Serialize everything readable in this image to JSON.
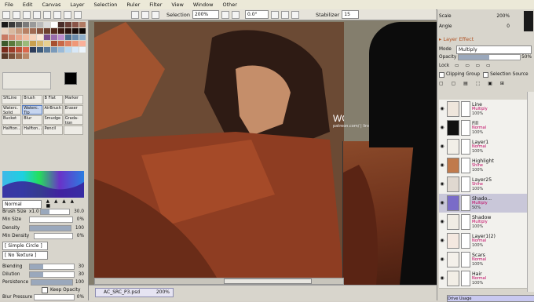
{
  "menu": [
    "File",
    "Edit",
    "Canvas",
    "Layer",
    "Selection",
    "Ruler",
    "Filter",
    "View",
    "Window",
    "Other"
  ],
  "toolbar": {
    "selection_label": "Selection",
    "zoom": "200%",
    "angle": "0.0°",
    "stabilizer_label": "Stabilizer",
    "stabilizer_value": "15"
  },
  "navigator": {
    "scale_label": "Scale",
    "scale_value": "200%",
    "angle_label": "Angle",
    "angle_value": "0"
  },
  "tools": [
    {
      "label": "SftLine"
    },
    {
      "label": "Brush"
    },
    {
      "label": "B Flat"
    },
    {
      "label": "Marker"
    },
    {
      "label": "Waterc. Solid"
    },
    {
      "label": "Waterc. Tip"
    },
    {
      "label": "AirBrush"
    },
    {
      "label": "Eraser"
    },
    {
      "label": "Bucket"
    },
    {
      "label": "Blur"
    },
    {
      "label": "Smudge"
    },
    {
      "label": "Grada-tion"
    },
    {
      "label": "Halfton..."
    },
    {
      "label": "Halfton..."
    },
    {
      "label": "Pencil"
    },
    {
      "label": ""
    }
  ],
  "brush": {
    "blend_mode": "Normal",
    "brush_size_label": "Brush Size",
    "brush_size_mult": "x1.0",
    "brush_size_value": "30.0",
    "min_size_label": "Min Size",
    "min_size_value": "0%",
    "density_label": "Density",
    "density_value": "100",
    "min_density_label": "Min Density",
    "min_density_value": "0%",
    "shape": "[ Simple Circle ]",
    "texture": "[ No Texture ]",
    "blending_label": "Blending",
    "blending_value": "30",
    "dilution_label": "Dilution",
    "dilution_value": "30",
    "persistence_label": "Persistence",
    "persistence_value": "100",
    "keep_opacity_label": "Keep Opacity",
    "blur_pressure_label": "Blur Pressure",
    "blur_pressure_value": "0%"
  },
  "layer_panel": {
    "effect_label": "Layer Effect",
    "mode_label": "Mode",
    "mode_value": "Multiply",
    "opacity_label": "Opacity",
    "opacity_value": "50%",
    "lock_label": "Lock",
    "clipping_label": "Clipping Group",
    "selection_source_label": "Selection Source",
    "layers": [
      {
        "name": "Line",
        "mode": "Multiply",
        "opacity": "100%"
      },
      {
        "name": "Fill",
        "mode": "Normal",
        "opacity": "100%"
      },
      {
        "name": "Layer1",
        "mode": "Normal",
        "opacity": "100%"
      },
      {
        "name": "Highlight",
        "mode": "Shine",
        "opacity": "100%"
      },
      {
        "name": "Layer25",
        "mode": "Shine",
        "opacity": "100%"
      },
      {
        "name": "Shado...",
        "mode": "Multiply",
        "opacity": "50%"
      },
      {
        "name": "Shadow",
        "mode": "Multiply",
        "opacity": "100%"
      },
      {
        "name": "Layer1(2)",
        "mode": "Normal",
        "opacity": "100%"
      },
      {
        "name": "Scars",
        "mode": "Normal",
        "opacity": "100%"
      },
      {
        "name": "Hair",
        "mode": "Normal",
        "opacity": "100%"
      }
    ],
    "drive_usage_label": "Drive Usage"
  },
  "canvas": {
    "watermark": "WORK IN PROGRESS",
    "watermark_sub": "patreon.com/ | linsloverfable"
  },
  "status": {
    "filename": "AC_SRC_P3.psd",
    "zoom": "200%"
  },
  "colors": {
    "primary": "#000000",
    "secondary": "#ffffff",
    "accent": "#5b7fbf"
  }
}
